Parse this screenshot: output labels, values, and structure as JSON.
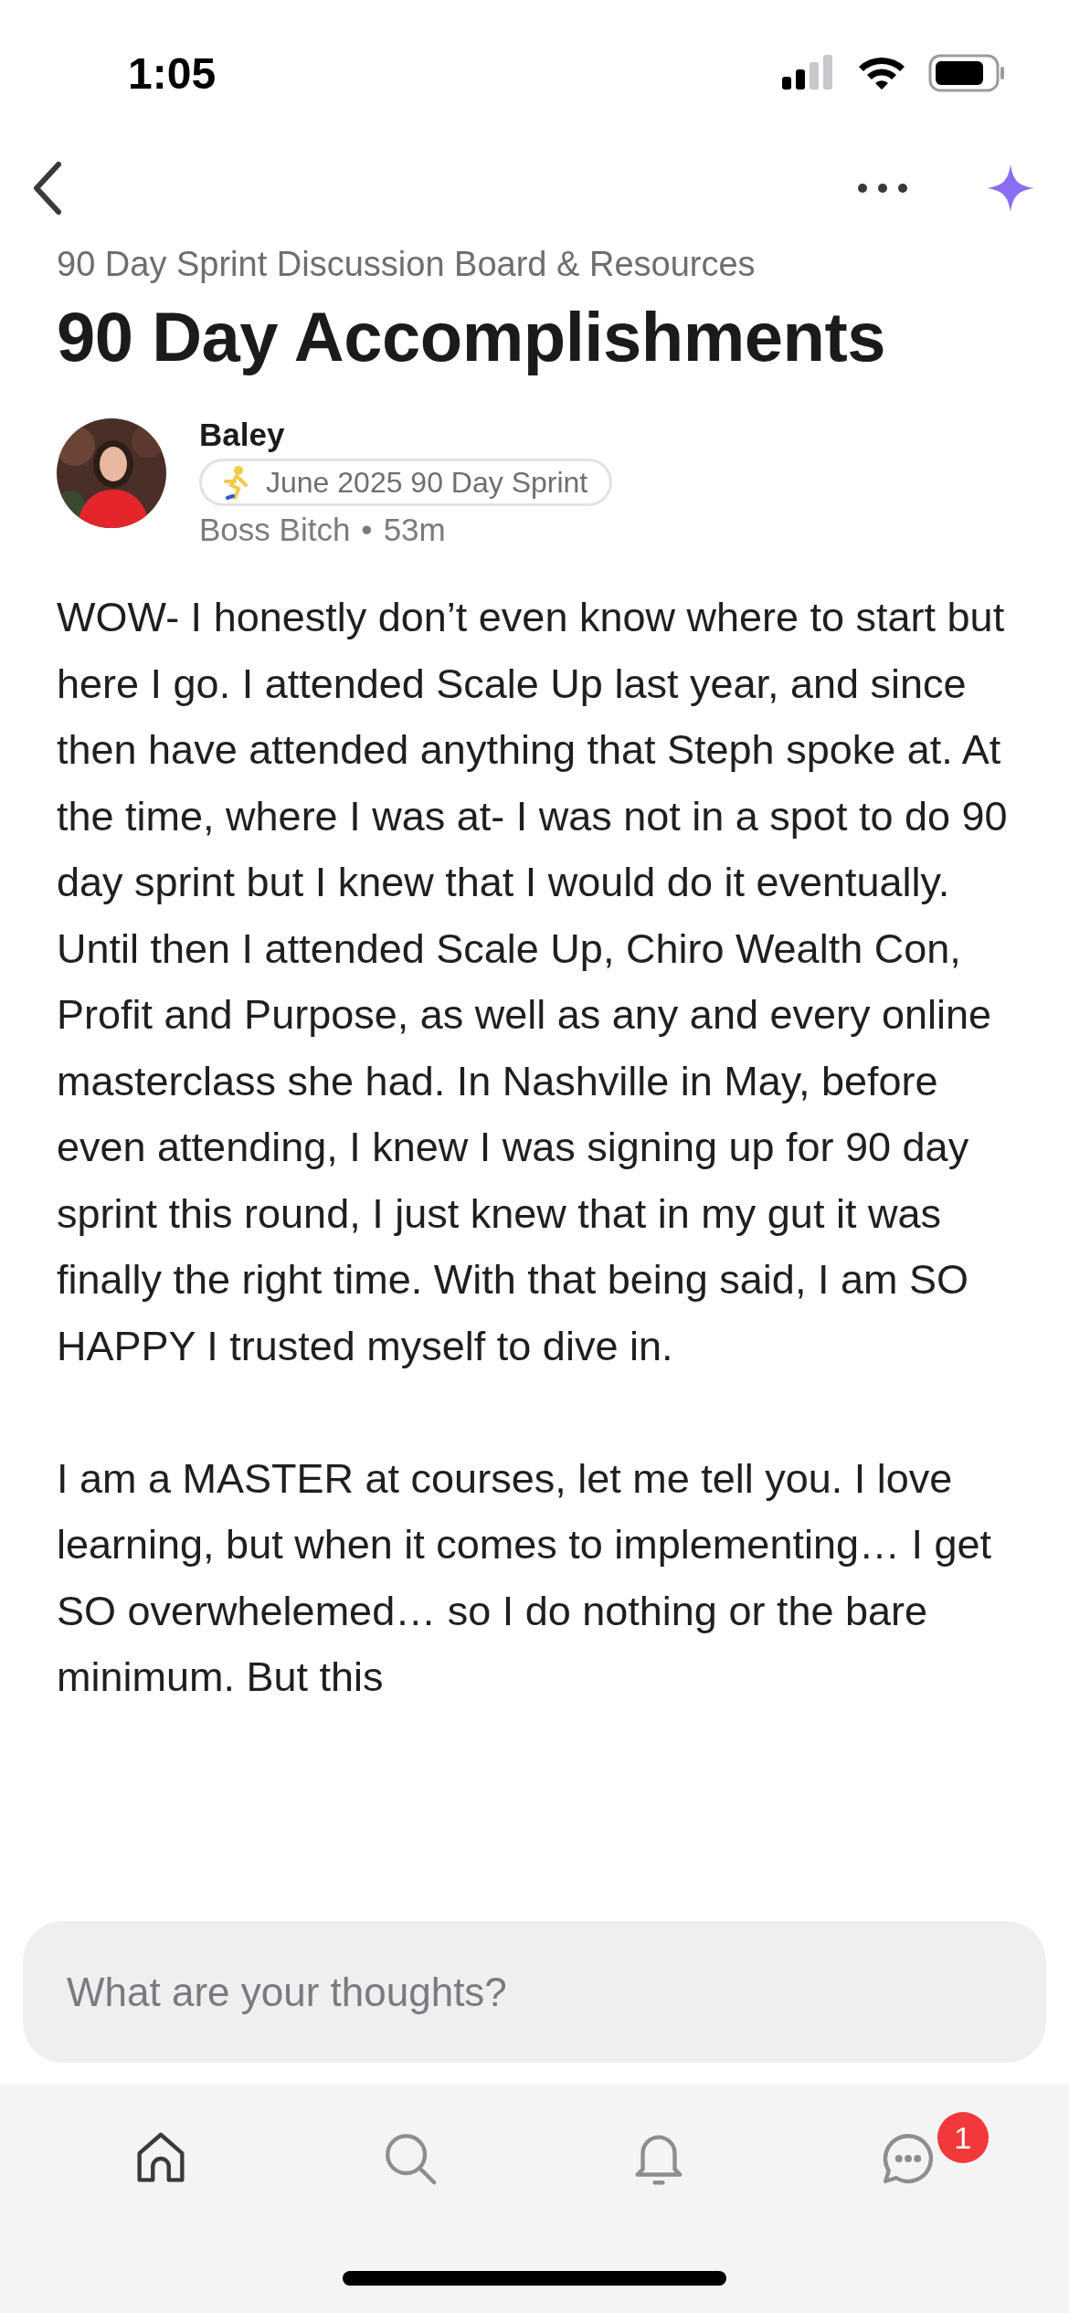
{
  "status_bar": {
    "time": "1:05"
  },
  "breadcrumb": "90 Day Sprint Discussion Board & Resources",
  "title": "90 Day Accomplishments",
  "author": {
    "name": "Baley",
    "badge": "June 2025 90 Day Sprint",
    "role": "Boss Bitch",
    "separator": "•",
    "age": "53m"
  },
  "body": [
    "WOW- I honestly don’t even know where to start but here I go. I attended Scale Up last year, and since then have attended anything that Steph spoke at. At the time, where I was at- I was not in a spot to do 90 day sprint but I knew that I would do it eventually. Until then I attended Scale Up, Chiro Wealth Con, Profit and Purpose, as well as any and every online masterclass she had. In Nashville in May, before even attending, I knew I was signing up for 90 day sprint this round, I just knew that in my gut it was finally the right time. With that being said, I am SO HAPPY I trusted myself to dive in.",
    "I am a MASTER at courses, let me tell you. I love learning, but when it comes to implementing… I get SO overwhelemed… so I do nothing or the bare minimum. But this"
  ],
  "comment_field": {
    "placeholder": "What are your thoughts?"
  },
  "tab_bar": [
    {
      "kind": "home",
      "selected": true
    },
    {
      "kind": "search",
      "selected": false
    },
    {
      "kind": "bell",
      "selected": false
    },
    {
      "kind": "chat",
      "selected": false,
      "badge": "1"
    }
  ]
}
